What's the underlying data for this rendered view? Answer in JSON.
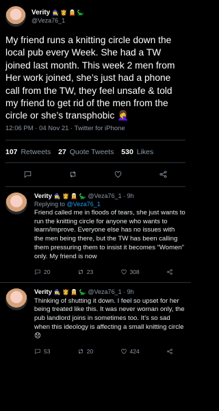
{
  "main_tweet": {
    "author_name": "Verity",
    "author_emojis": "🧙‍♀️ 👸 🧝 🦕",
    "handle": "@Veza76_1",
    "text": "My friend runs a knitting circle down the local pub every Week. She had a TW joined last month. This week 2 men from Her work joined, she’s just had a phone call from the TW, they feel unsafe & told my friend to get rid of the men from the circle or she’s transphobic 🤦‍♀️",
    "timestamp": "12:06 PM · 04 Nov 21 · Twitter for iPhone",
    "retweets_count": "107",
    "retweets_label": "Retweets",
    "quote_count": "27",
    "quote_label": "Quote Tweets",
    "likes_count": "530",
    "likes_label": "Likes"
  },
  "replies": [
    {
      "author_name": "Verity",
      "author_emojis": "🧙‍♀️ 👸 🧝 🦕",
      "handle": "@Veza76_1 · 9h",
      "replying_prefix": "Replying to",
      "replying_handle": "@Veza76_1",
      "text": "Friend called me in floods of tears, she just wants to run the knitting circle for anyone who wants to learn/improve. Everyone else has no issues with the men being there,  but the TW has been calling them pressuring them to insist it becomes “Women” only. My friend is now",
      "replies": "20",
      "retweets": "23",
      "likes": "308"
    },
    {
      "author_name": "Verity",
      "author_emojis": "🧙‍♀️ 👸 🧝 🦕",
      "handle": "@Veza76_1 · 9h",
      "text": "Thinking of shutting it down. I feel so upset for her being treated like this. It was never woman only, the pub landlord joins in sometimes too. It’s so sad when this ideology is affecting  a small knitting circle 😞",
      "replies": "53",
      "retweets": "20",
      "likes": "424"
    }
  ],
  "icons": {
    "reply": "speech-bubble-icon",
    "retweet": "retweet-icon",
    "like": "heart-icon",
    "share": "share-icon",
    "more": "more-dots-icon"
  },
  "colors": {
    "background": "#000000",
    "text": "#e7e9ea",
    "muted": "#8b98a5",
    "link": "#1d9bf0",
    "divider": "#2f3336"
  }
}
